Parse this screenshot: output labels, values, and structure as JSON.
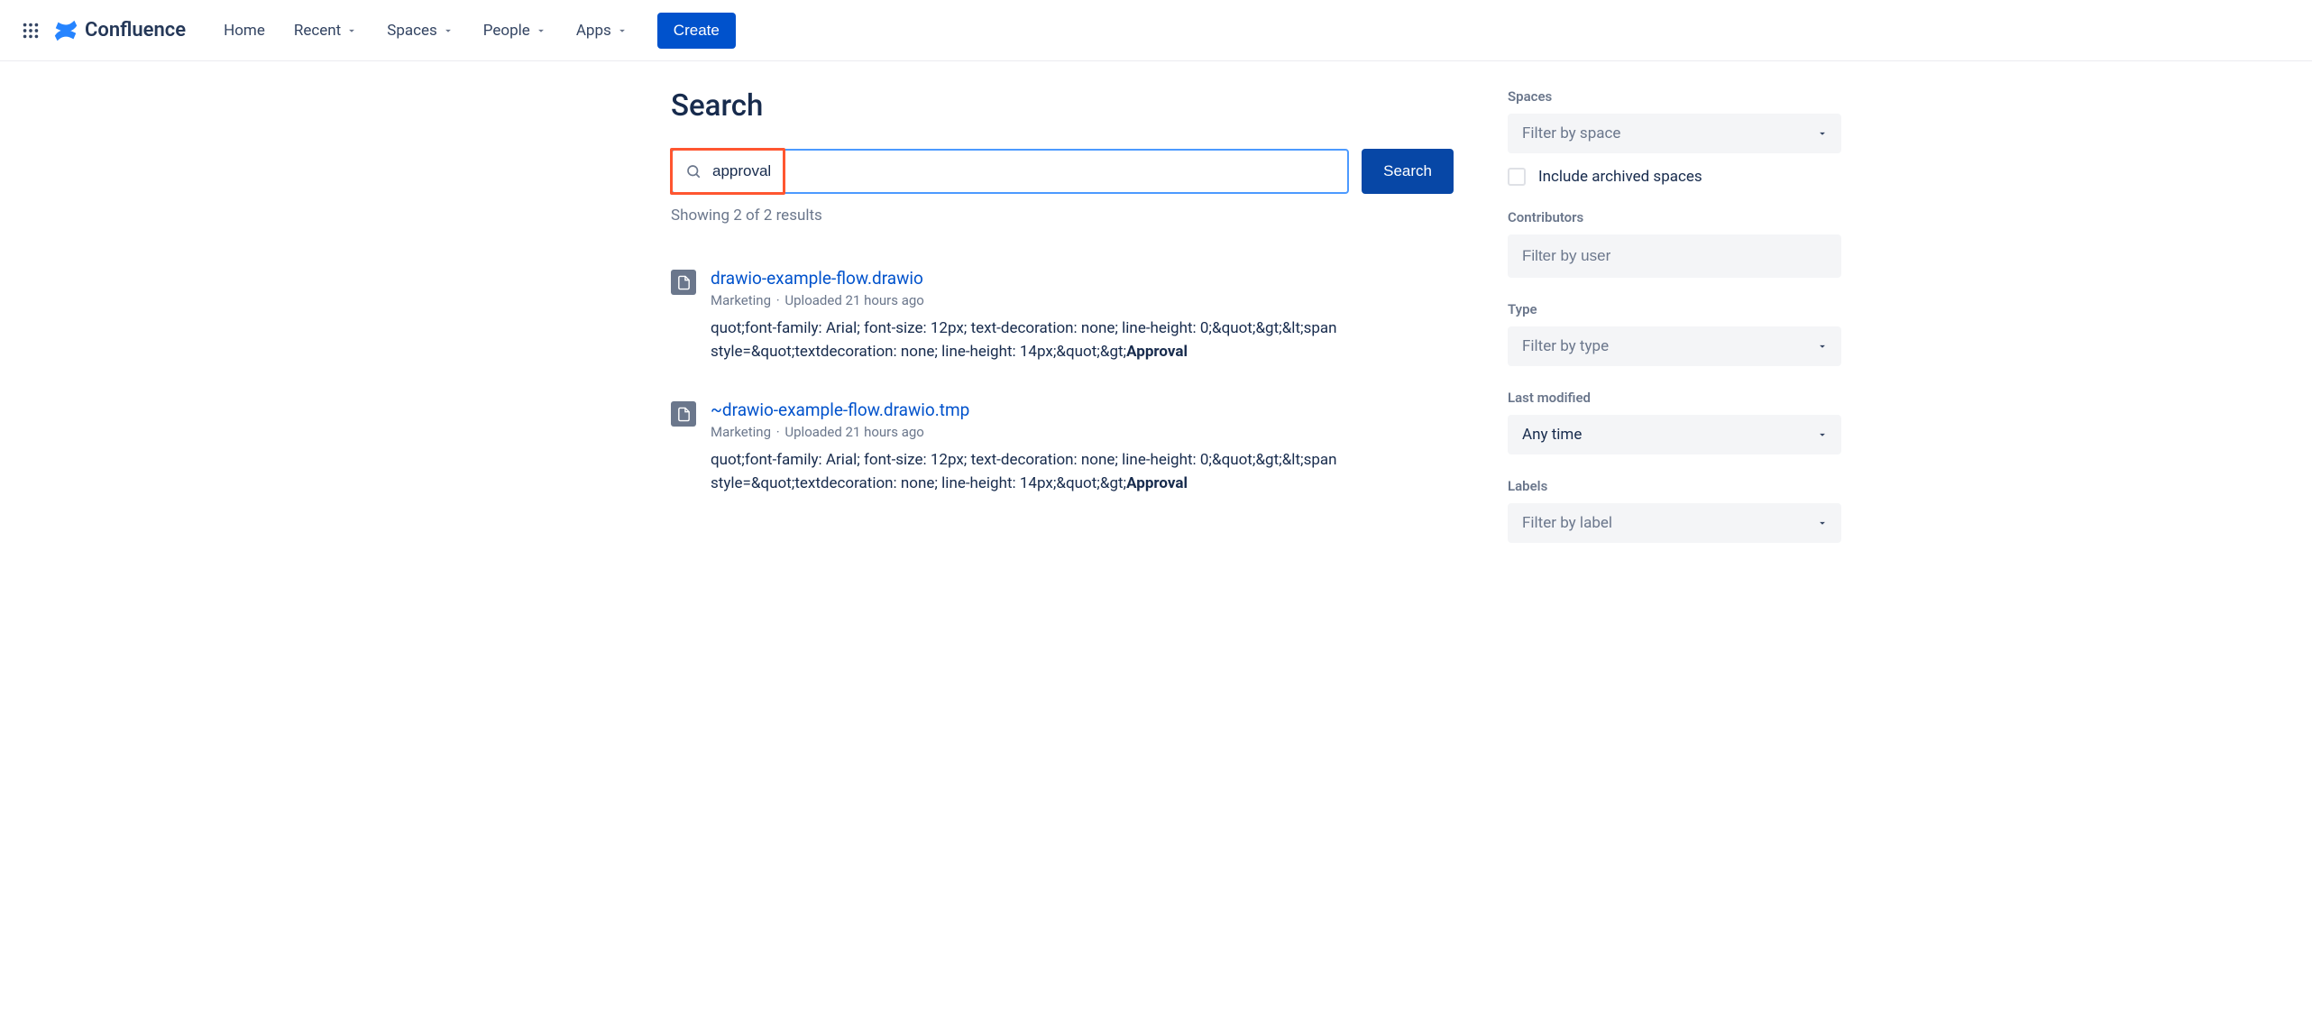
{
  "header": {
    "product_name": "Confluence",
    "nav": {
      "home": "Home",
      "recent": "Recent",
      "spaces": "Spaces",
      "people": "People",
      "apps": "Apps"
    },
    "create_label": "Create"
  },
  "search": {
    "title": "Search",
    "query": "approval",
    "search_button": "Search",
    "result_count_text": "Showing 2 of 2 results"
  },
  "results": [
    {
      "title": "drawio-example-flow.drawio",
      "space": "Marketing",
      "uploaded": "Uploaded 21 hours ago",
      "snippet_plain": "quot;font-family: Arial; font-size: 12px; text-decoration: none; line-height: 0;&quot;&gt;&lt;span style=&quot;textdecoration: none; line-height: 14px;&quot;&gt;",
      "snippet_bold": "Approval"
    },
    {
      "title": "~drawio-example-flow.drawio.tmp",
      "space": "Marketing",
      "uploaded": "Uploaded 21 hours ago",
      "snippet_plain": "quot;font-family: Arial; font-size: 12px; text-decoration: none; line-height: 0;&quot;&gt;&lt;span style=&quot;textdecoration: none; line-height: 14px;&quot;&gt;",
      "snippet_bold": "Approval"
    }
  ],
  "filters": {
    "spaces": {
      "label": "Spaces",
      "placeholder": "Filter by space",
      "archived_checkbox": "Include archived spaces"
    },
    "contributors": {
      "label": "Contributors",
      "placeholder": "Filter by user"
    },
    "type": {
      "label": "Type",
      "placeholder": "Filter by type"
    },
    "last_modified": {
      "label": "Last modified",
      "value": "Any time"
    },
    "labels": {
      "label": "Labels",
      "placeholder": "Filter by label"
    }
  }
}
